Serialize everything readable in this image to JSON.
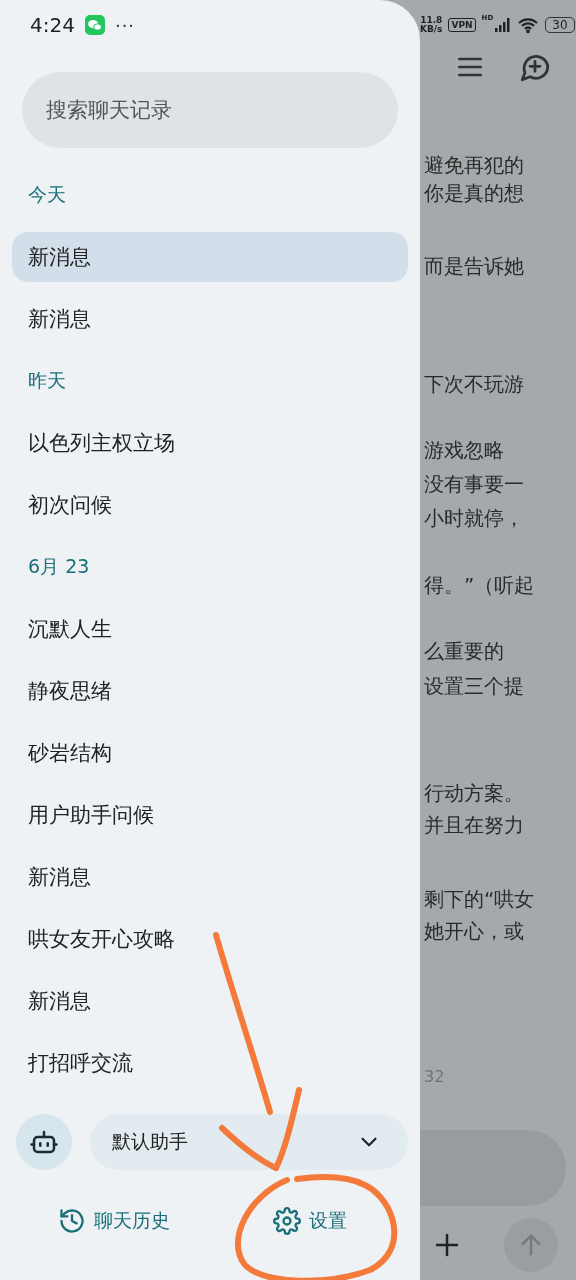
{
  "status_bar": {
    "time": "4:24",
    "more": "···",
    "net_speed": "11.8",
    "net_unit": "KB/s",
    "vpn": "VPN",
    "signal_label": "HD",
    "battery": "30"
  },
  "search": {
    "placeholder": "搜索聊天记录"
  },
  "history": [
    {
      "kind": "header",
      "label": "今天"
    },
    {
      "kind": "item",
      "label": "新消息",
      "selected": true
    },
    {
      "kind": "item",
      "label": "新消息",
      "selected": false
    },
    {
      "kind": "header",
      "label": "昨天"
    },
    {
      "kind": "item",
      "label": "以色列主权立场",
      "selected": false
    },
    {
      "kind": "item",
      "label": "初次问候",
      "selected": false
    },
    {
      "kind": "header",
      "label": "6月 23"
    },
    {
      "kind": "item",
      "label": "沉默人生",
      "selected": false
    },
    {
      "kind": "item",
      "label": "静夜思绪",
      "selected": false
    },
    {
      "kind": "item",
      "label": "砂岩结构",
      "selected": false
    },
    {
      "kind": "item",
      "label": "用户助手问候",
      "selected": false
    },
    {
      "kind": "item",
      "label": "新消息",
      "selected": false
    },
    {
      "kind": "item",
      "label": "哄女友开心攻略",
      "selected": false
    },
    {
      "kind": "item",
      "label": "新消息",
      "selected": false
    },
    {
      "kind": "item",
      "label": "打招呼交流",
      "selected": false
    }
  ],
  "assistant": {
    "label": "默认助手"
  },
  "footer": [
    {
      "kind": "history",
      "label": "聊天历史"
    },
    {
      "kind": "settings",
      "label": "设置"
    }
  ],
  "background_chat": {
    "lines": [
      "避免再犯的",
      "你是真的想",
      "而是告诉她",
      "下次不玩游",
      "游戏忽略",
      "没有事要一",
      "小时就停，",
      "得。”（听起",
      "么重要的",
      "设置三个提",
      "行动方案。",
      "并且在努力",
      "剩下的“哄女",
      "她开心，或"
    ],
    "timestamp": "32"
  }
}
